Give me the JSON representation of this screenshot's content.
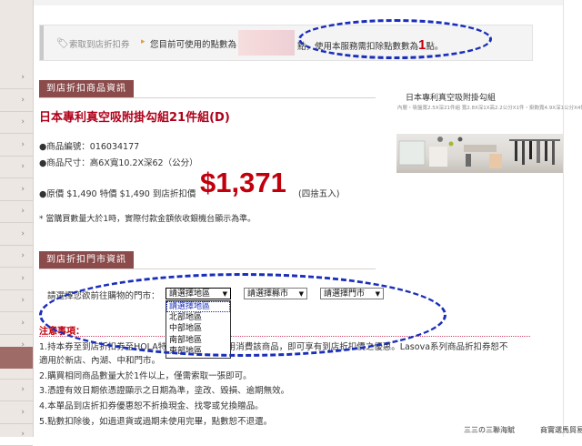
{
  "sidebar": {
    "chevron": "›",
    "rows": 17
  },
  "coupon": {
    "icon": "tag-icon",
    "label": "索取到店折扣券",
    "separator_icon": "arrow-icon",
    "message_prefix": "您目前可使用的點數為",
    "message_suffix": "點，使用本服務需扣除點數數為",
    "points_required": "1",
    "points_unit": "點。"
  },
  "product_section": {
    "heading": "到店折扣商品資訊"
  },
  "product": {
    "title": "日本專利真空吸附掛勾組21件組(D)",
    "code_line": "●商品編號：016034177",
    "size_line": "●商品尺寸：高6X寬10.2X深62（公分）",
    "price_line": "●原價 $1,490 特價 $1,490 到店折扣價",
    "discount_price": "$1,371",
    "price_note": "(四捨五入)",
    "qty_note": "* 當購買數量大於1時，實際付款金額依收銀機台顯示為準。",
    "card_title": "日本專利真空吸附掛勾組",
    "card_sub": "內層・吸盤寬2.5X深21件組 寬2.8X深1X高2.2公分X1件・掛鉤寬4.9X深1公分X4件"
  },
  "store_section": {
    "heading": "到店折扣門市資訊",
    "prompt": "請選擇您欲前往購物的門市：",
    "region_select": "請選擇地區",
    "city_select": "請選擇縣市",
    "store_select": "請選擇門市",
    "region_options": [
      "請選擇地區",
      "北部地區",
      "中部地區",
      "南部地區",
      "東部地區"
    ]
  },
  "notice": {
    "title": "注意事項：",
    "items": [
      "1.持本券至到店折扣券至HOLA特力和樂門市，使用消費該商品，即可享有到店折扣價之優惠。Lasova系列商品折扣券恕不",
      "   適用於新店、內湖、中和門市。",
      "2.購買相同商品數量大於1件以上，僅需索取一張即可。",
      "3.憑證有效日期依憑證顯示之日期為準，塗改、毀損、逾期無效。",
      "4.本單品到店折扣券優惠恕不折換現金、找零或兌換贈品。",
      "5.點數扣除後，如過退貨或過期未使用完畢，點數恕不退還。"
    ]
  },
  "footer": {
    "link1": "三三の三聯海賦",
    "link2": "商實選馬貿易"
  },
  "colors": {
    "accent": "#8b4b4b",
    "price_red": "#c0000c",
    "annotation_blue": "#1a2fb8"
  }
}
